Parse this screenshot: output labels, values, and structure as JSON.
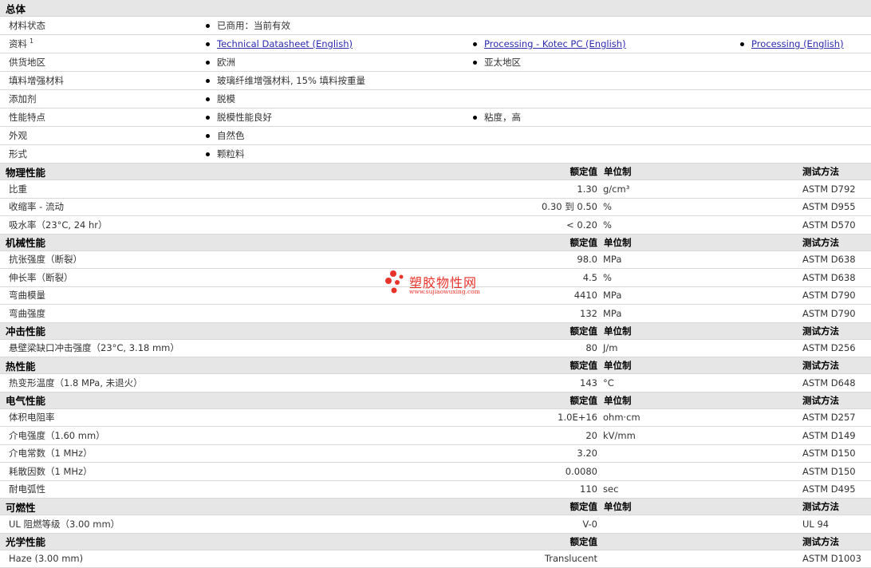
{
  "general": {
    "title": "总体",
    "rows": [
      {
        "label": "材料状态",
        "items": [
          "已商用：当前有效"
        ]
      },
      {
        "label": "资料",
        "sup": "1",
        "links": [
          "Technical Datasheet (English)",
          "Processing - Kotec PC (English)",
          "Processing (English)"
        ]
      },
      {
        "label": "供货地区",
        "items": [
          "欧洲",
          "亚太地区"
        ]
      },
      {
        "label": "填料增强材料",
        "items": [
          "玻璃纤维增强材料, 15% 填料按重量"
        ]
      },
      {
        "label": "添加剂",
        "items": [
          "脱模"
        ]
      },
      {
        "label": "性能特点",
        "items": [
          "脱模性能良好",
          "粘度，高"
        ]
      },
      {
        "label": "外观",
        "items": [
          "自然色"
        ]
      },
      {
        "label": "形式",
        "items": [
          "颗粒料"
        ]
      }
    ]
  },
  "headers": {
    "nominal": "额定值",
    "unit": "单位制",
    "test": "测试方法"
  },
  "sections": [
    {
      "title": "物理性能",
      "rows": [
        {
          "label": "比重",
          "value": "1.30",
          "unit": "g/cm³",
          "test": "ASTM D792"
        },
        {
          "label": "收缩率  - 流动",
          "value": "0.30 到  0.50",
          "unit": "%",
          "test": "ASTM D955"
        },
        {
          "label": "吸水率（23°C, 24 hr）",
          "value": "< 0.20",
          "unit": "%",
          "test": "ASTM D570"
        }
      ]
    },
    {
      "title": "机械性能",
      "rows": [
        {
          "label": "抗张强度（断裂）",
          "value": "98.0",
          "unit": "MPa",
          "test": "ASTM D638"
        },
        {
          "label": "伸长率（断裂）",
          "value": "4.5",
          "unit": "%",
          "test": "ASTM D638"
        },
        {
          "label": "弯曲模量",
          "value": "4410",
          "unit": "MPa",
          "test": "ASTM D790"
        },
        {
          "label": "弯曲强度",
          "value": "132",
          "unit": "MPa",
          "test": "ASTM D790"
        }
      ]
    },
    {
      "title": "冲击性能",
      "rows": [
        {
          "label": "悬壁梁缺口冲击强度（23°C, 3.18 mm）",
          "value": "80",
          "unit": "J/m",
          "test": "ASTM D256"
        }
      ]
    },
    {
      "title": "热性能",
      "rows": [
        {
          "label": "热变形温度（1.8 MPa, 未退火）",
          "value": "143",
          "unit": "°C",
          "test": "ASTM D648"
        }
      ]
    },
    {
      "title": "电气性能",
      "rows": [
        {
          "label": "体积电阻率",
          "value": "1.0E+16",
          "unit": "ohm·cm",
          "test": "ASTM D257"
        },
        {
          "label": "介电强度（1.60 mm）",
          "value": "20",
          "unit": "kV/mm",
          "test": "ASTM D149"
        },
        {
          "label": "介电常数（1 MHz）",
          "value": "3.20",
          "unit": "",
          "test": "ASTM D150"
        },
        {
          "label": "耗散因数（1 MHz）",
          "value": "0.0080",
          "unit": "",
          "test": "ASTM D150"
        },
        {
          "label": "耐电弧性",
          "value": "110",
          "unit": "sec",
          "test": "ASTM D495"
        }
      ]
    },
    {
      "title": "可燃性",
      "rows": [
        {
          "label": "UL 阻燃等级（3.00 mm）",
          "value": "V-0",
          "unit": "",
          "test": "UL 94"
        }
      ]
    },
    {
      "title": "光学性能",
      "rows": [
        {
          "label": "Haze (3.00 mm)",
          "value": "Translucent",
          "unit": "",
          "test": "ASTM D1003"
        }
      ]
    }
  ],
  "watermark": {
    "text": "塑胶物性网",
    "url": "www.sujiaowuxing.com",
    "color": "#e8332a"
  }
}
